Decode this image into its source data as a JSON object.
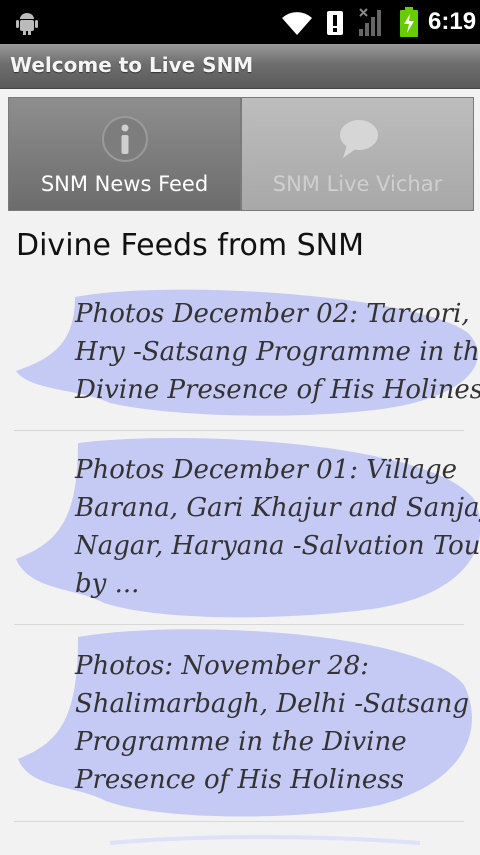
{
  "status_bar": {
    "time": "6:19",
    "icons": [
      "android-icon",
      "wifi-icon",
      "alert-icon",
      "signal-icon",
      "battery-icon"
    ],
    "battery_color": "#66cc00"
  },
  "app": {
    "title": "Welcome to Live SNM"
  },
  "tabs": [
    {
      "label": "SNM News Feed",
      "icon": "info-icon",
      "active": true
    },
    {
      "label": "SNM Live Vichar",
      "icon": "speech-bubble-icon",
      "active": false
    }
  ],
  "feed": {
    "heading": "Divine Feeds from SNM",
    "bubble_color": "#c5caf5",
    "items": [
      {
        "lines": [
          "Photos December 02: Taraori,",
          "Hry -Satsang Programme in the",
          "Divine Presence of His Holiness"
        ]
      },
      {
        "lines": [
          "Photos December 01: Village",
          "Barana, Gari Khajur and Sanjay",
          "Nagar, Haryana -Salvation Tour",
          "by ..."
        ]
      },
      {
        "lines": [
          "Photos: November 28:",
          "Shalimarbagh, Delhi -Satsang",
          "Programme in the Divine",
          "Presence of His Holiness"
        ]
      }
    ]
  }
}
